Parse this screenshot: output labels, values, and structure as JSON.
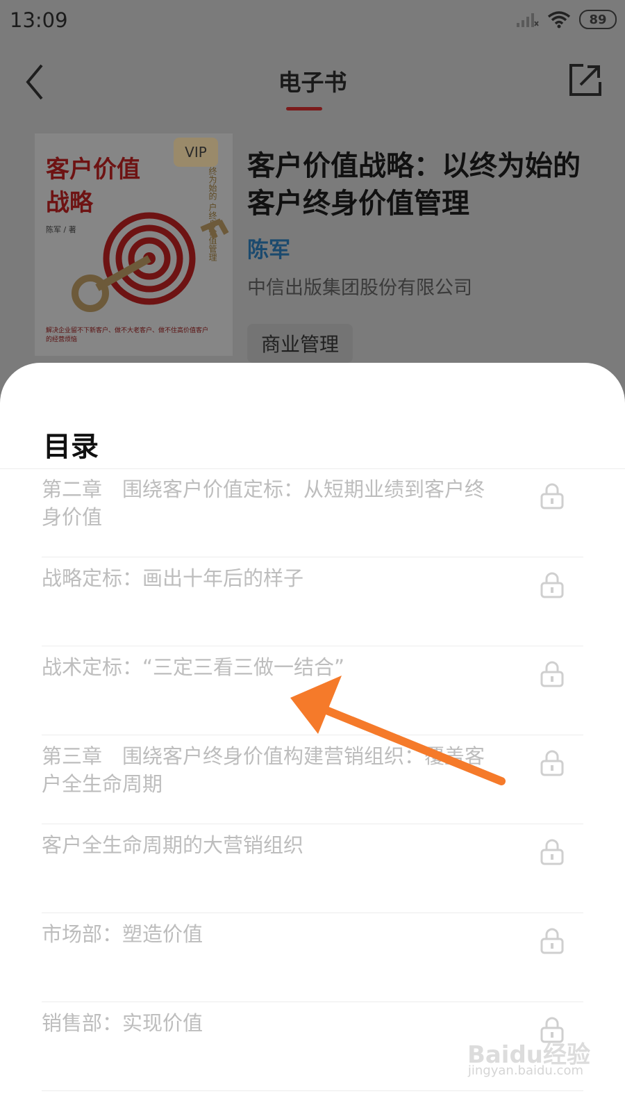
{
  "status_bar": {
    "time": "13:09",
    "battery": "89"
  },
  "nav": {
    "title": "电子书"
  },
  "book": {
    "cover_title": "客户价值\n战略",
    "cover_vip": "VIP",
    "cover_side_text": "终为始的 户终身价值管理",
    "cover_author": "陈军 / 著",
    "cover_blurb": "解决企业留不下新客户、做不大老客户、做不住高价值客户的经营烦恼",
    "title": "客户价值战略：以终为始的客户终身价值管理",
    "author": "陈军",
    "publisher": "中信出版集团股份有限公司",
    "tag": "商业管理"
  },
  "toc": {
    "title": "目录",
    "items": [
      "第二章　围绕客户价值定标：从短期业绩到客户终身价值",
      "战略定标：画出十年后的样子",
      "战术定标：“三定三看三做一结合”",
      "第三章　围绕客户终身价值构建营销组织：覆盖客户全生命周期",
      "客户全生命周期的大营销组织",
      "市场部：塑造价值",
      "销售部：实现价值"
    ]
  },
  "watermark": {
    "main": "Baidu经验",
    "sub": "jingyan.baidu.com"
  },
  "colors": {
    "accent": "#d0222a",
    "arrow": "#f57a2a",
    "author_link": "#2a7fc0"
  }
}
